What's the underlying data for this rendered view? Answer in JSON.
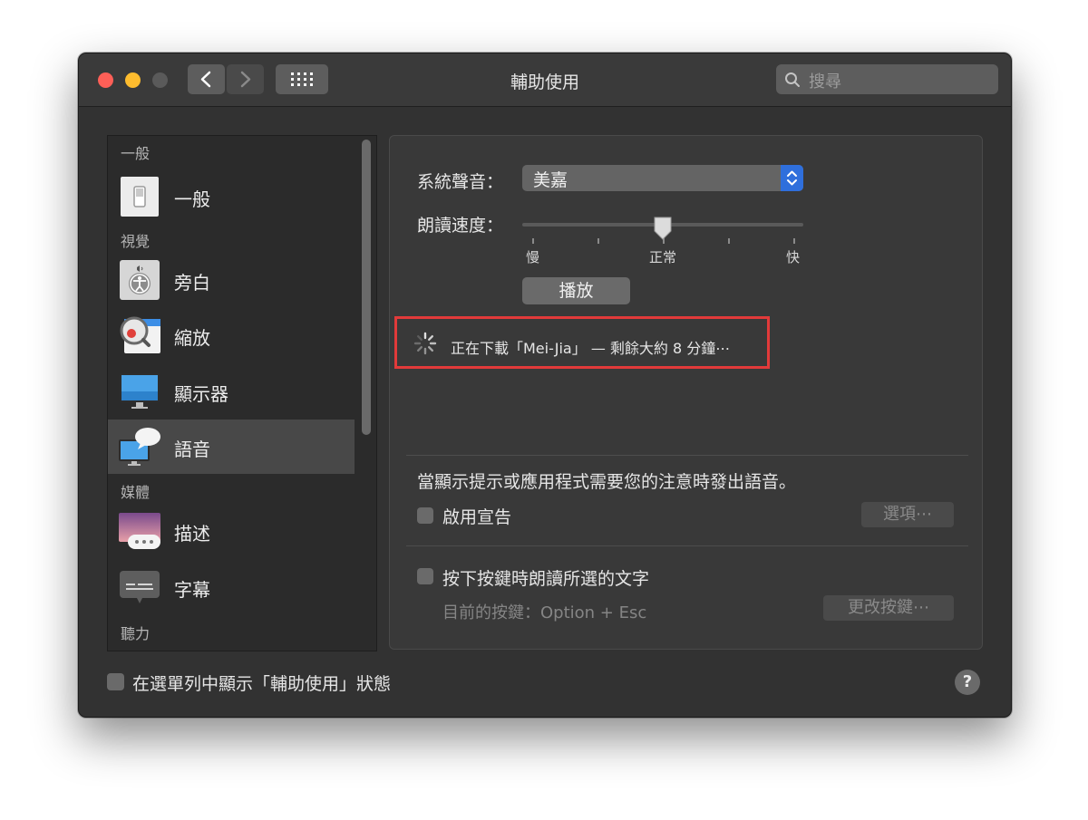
{
  "window": {
    "title": "輔助使用"
  },
  "toolbar": {
    "back_icon": "chevron-left",
    "forward_icon": "chevron-right",
    "show_all_icon": "grid",
    "search_placeholder": "搜尋"
  },
  "sidebar": {
    "sections": {
      "general": "一般",
      "vision": "視覺",
      "media": "媒體",
      "hearing": "聽力"
    },
    "items": [
      {
        "label": "一般",
        "icon": "general-switch-icon"
      },
      {
        "label": "旁白",
        "icon": "voiceover-icon"
      },
      {
        "label": "縮放",
        "icon": "zoom-icon"
      },
      {
        "label": "顯示器",
        "icon": "display-icon"
      },
      {
        "label": "語音",
        "icon": "speech-icon",
        "selected": true
      },
      {
        "label": "描述",
        "icon": "descriptions-icon"
      },
      {
        "label": "字幕",
        "icon": "captions-icon"
      }
    ]
  },
  "speech": {
    "system_voice_label": "系統聲音：",
    "system_voice_value": "美嘉",
    "speaking_rate_label": "朗讀速度：",
    "rate_slow": "慢",
    "rate_normal": "正常",
    "rate_fast": "快",
    "rate_level": 0.5,
    "play_button": "播放",
    "download_status": "正在下載「Mei-Jia」 — 剩餘大約 8 分鐘⋯",
    "announce_description": "當顯示提示或應用程式需要您的注意時發出語音。",
    "enable_announcements": "啟用宣告",
    "options_button": "選項⋯",
    "speak_selected_text": "按下按鍵時朗讀所選的文字",
    "current_key": "目前的按鍵：Option + Esc",
    "change_key_button": "更改按鍵⋯"
  },
  "footer": {
    "show_in_menubar": "在選單列中顯示「輔助使用」狀態",
    "help_glyph": "?"
  },
  "colors": {
    "highlight_box": "#e23a3a",
    "selected_row": "#484848",
    "stepper_blue": "#2f6fdc"
  }
}
